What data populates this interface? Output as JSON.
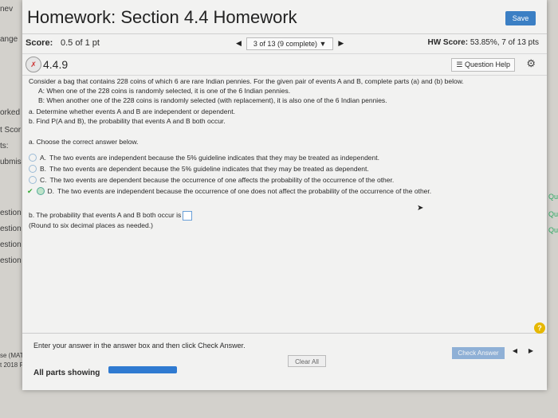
{
  "background": {
    "left_fragments": [
      "nev",
      "ange",
      "orked",
      "t Scor",
      "ts:",
      "ubmis",
      "estion",
      "estion",
      "estion",
      "estion",
      "se (MATI",
      "t 2018 P"
    ],
    "right_fragments": [
      "Que",
      "Que",
      "Que"
    ]
  },
  "header": {
    "title": "Homework: Section 4.4 Homework",
    "save_label": "Save"
  },
  "scorebar": {
    "score_label": "Score:",
    "score_value": "0.5 of 1 pt",
    "pager_text": "3 of 13 (9 complete)",
    "hw_score_label": "HW Score:",
    "hw_score_value": "53.85%, 7 of 13 pts"
  },
  "question": {
    "number": "4.4.9",
    "help_label": "Question Help",
    "intro": "Consider a bag that contains 228 coins of which 6 are rare Indian pennies. For the given pair of events A and B, complete parts (a) and (b) below.",
    "event_a": "A: When one of the 228 coins is randomly selected, it is one of the 6 Indian pennies.",
    "event_b": "B: When another one of the 228 coins is randomly selected (with replacement), it is also one of the 6 Indian pennies.",
    "part_a": "a. Determine whether events A and B are independent or dependent.",
    "part_b": "b. Find P(A and B), the probability that events A and B both occur.",
    "part_a_prompt": "a. Choose the correct answer below.",
    "choices": [
      {
        "letter": "A.",
        "text": "The two events are independent because the 5% guideline indicates that they may be treated as independent."
      },
      {
        "letter": "B.",
        "text": "The two events are dependent because the 5% guideline indicates that they may be treated as dependent."
      },
      {
        "letter": "C.",
        "text": "The two events are dependent because the occurrence of one affects the probability of the occurrence of the other."
      },
      {
        "letter": "D.",
        "text": "The two events are independent because the occurrence of one does not affect the probability of the occurrence of the other."
      }
    ],
    "selected": "D",
    "part_b_prompt": "b. The probability that events A and B both occur is",
    "part_b_note": "(Round to six decimal places as needed.)"
  },
  "footer": {
    "instruction": "Enter your answer in the answer box and then click Check Answer.",
    "clear_label": "Clear All",
    "check_label": "Check Answer",
    "parts_label": "All parts showing",
    "help_glyph": "?"
  },
  "colors": {
    "accent": "#3b7fc4",
    "progress": "#2f7ad1",
    "check_button": "#8fb0d6"
  }
}
